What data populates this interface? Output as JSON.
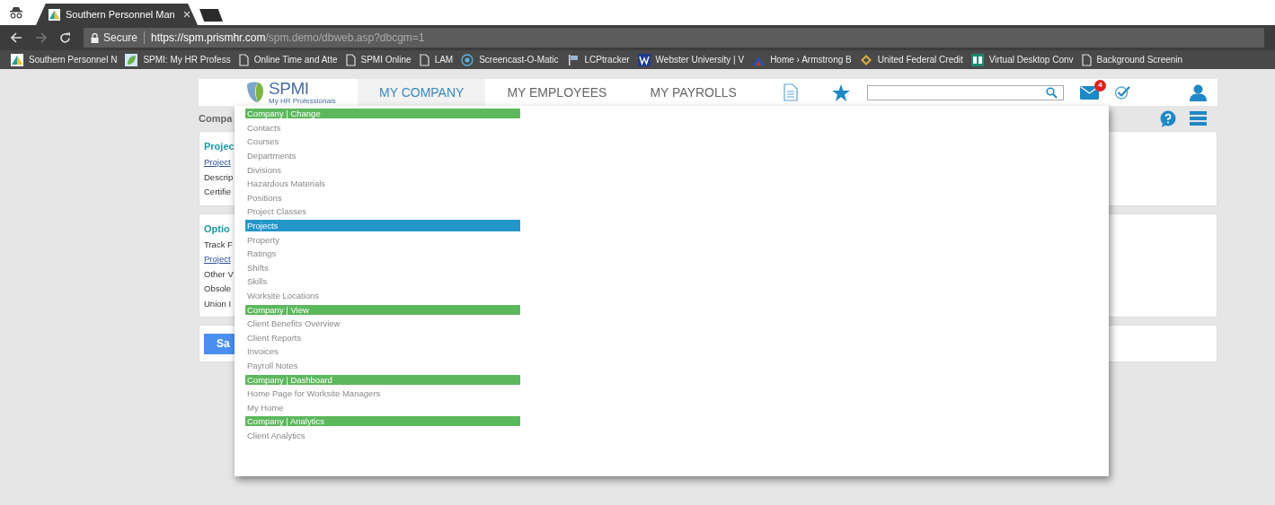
{
  "browser": {
    "tabs": [
      {
        "title": "Southern Personnel Man",
        "selected": true
      },
      {
        "kind": "new",
        "selected": false
      }
    ],
    "address": {
      "secure_label": "Secure",
      "url_host": "https://spm.prismhr.com",
      "url_path": "/spm.demo/dbweb.asp?dbcgm=1"
    },
    "bookmarks": [
      {
        "label": "Southern Personnel N",
        "kind": "triangle"
      },
      {
        "label": "SPMI: My HR Profess",
        "kind": "leaf"
      },
      {
        "label": "Online Time and Atte",
        "kind": "page"
      },
      {
        "label": "SPMI Online",
        "kind": "page"
      },
      {
        "label": "LAM",
        "kind": "page"
      },
      {
        "label": "Screencast-O-Matic",
        "kind": "circle"
      },
      {
        "label": "LCPtracker",
        "kind": "flag"
      },
      {
        "label": "Webster University | V",
        "kind": "w"
      },
      {
        "label": "Home › Armstrong B",
        "kind": "arch"
      },
      {
        "label": "United Federal Credit",
        "kind": "diamond"
      },
      {
        "label": "Virtual Desktop Conv",
        "kind": "fz"
      },
      {
        "label": "Background Screenin",
        "kind": "page"
      }
    ]
  },
  "header": {
    "logo": "SPMI",
    "tagline": "My HR Professionals",
    "nav": [
      {
        "label": "MY COMPANY",
        "selected": true
      },
      {
        "label": "MY EMPLOYEES",
        "selected": false
      },
      {
        "label": "MY PAYROLLS",
        "selected": false
      }
    ],
    "mail_badge": "4"
  },
  "page": {
    "title": "Compa",
    "cards": [
      {
        "title": "Projec",
        "rows": [
          {
            "text": "Project",
            "kind": "link"
          },
          {
            "text": "Descrip",
            "kind": "text"
          },
          {
            "text": "Certifie",
            "kind": "text"
          }
        ]
      },
      {
        "title": "Optio",
        "rows": [
          {
            "text": "Track F",
            "kind": "text"
          },
          {
            "text": "Project",
            "kind": "link"
          },
          {
            "text": "Other V",
            "kind": "text"
          },
          {
            "text": "Obsole",
            "kind": "text"
          },
          {
            "text": "Union I",
            "kind": "text"
          }
        ]
      }
    ],
    "save_button": "Sa"
  },
  "menu": {
    "sections": [
      {
        "header": "Company | Change",
        "items": [
          {
            "label": "Contacts",
            "selected": false
          },
          {
            "label": "Courses",
            "selected": false
          },
          {
            "label": "Departments",
            "selected": false
          },
          {
            "label": "Divisions",
            "selected": false
          },
          {
            "label": "Hazardous Materials",
            "selected": false
          },
          {
            "label": "Positions",
            "selected": false
          },
          {
            "label": "Project Classes",
            "selected": false
          },
          {
            "label": "Projects",
            "selected": true
          },
          {
            "label": "Property",
            "selected": false
          },
          {
            "label": "Ratings",
            "selected": false
          },
          {
            "label": "Shifts",
            "selected": false
          },
          {
            "label": "Skills",
            "selected": false
          },
          {
            "label": "Worksite Locations",
            "selected": false
          }
        ]
      },
      {
        "header": "Company | View",
        "items": [
          {
            "label": "Client Benefits Overview",
            "selected": false
          },
          {
            "label": "Client Reports",
            "selected": false
          },
          {
            "label": "Invoices",
            "selected": false
          },
          {
            "label": "Payroll Notes",
            "selected": false
          }
        ]
      },
      {
        "header": "Company | Dashboard",
        "items": [
          {
            "label": "Home Page for Worksite Managers",
            "selected": false
          },
          {
            "label": "My Home",
            "selected": false
          }
        ]
      },
      {
        "header": "Company | Analytics",
        "items": [
          {
            "label": "Client Analytics",
            "selected": false
          }
        ]
      }
    ]
  }
}
